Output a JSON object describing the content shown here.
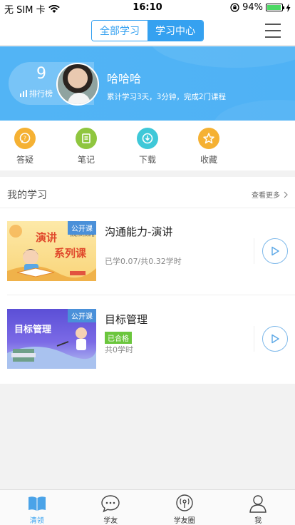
{
  "status_bar": {
    "carrier": "无 SIM 卡",
    "time": "16:10",
    "battery_text": "94%",
    "battery_level": 0.94
  },
  "nav": {
    "tabs": [
      {
        "label": "全部学习",
        "active": false
      },
      {
        "label": "学习中心",
        "active": true
      }
    ]
  },
  "profile": {
    "rank_number": "9",
    "rank_label": "排行榜",
    "name": "哈哈哈",
    "summary": "累计学习3天，3分钟，完成2门课程"
  },
  "quick_actions": [
    {
      "label": "答疑",
      "icon": "qa-icon",
      "color": "#f5b133"
    },
    {
      "label": "笔记",
      "icon": "note-icon",
      "color": "#8fc63f"
    },
    {
      "label": "下载",
      "icon": "download-icon",
      "color": "#3fc8d8"
    },
    {
      "label": "收藏",
      "icon": "star-icon",
      "color": "#f5b133"
    }
  ],
  "study": {
    "title": "我的学习",
    "more_label": "查看更多",
    "courses": [
      {
        "title": "沟通能力-演讲",
        "progress": "已学0.07/共0.32学时",
        "tag": "公开课",
        "thumb_title": "演讲",
        "thumb_subtitle": "系列课",
        "thumb_small": "我是你的演讲官"
      },
      {
        "title": "目标管理",
        "badge": "已合格",
        "progress": "共0学时",
        "tag": "公开课",
        "thumb_title": "目标管理"
      }
    ]
  },
  "tab_bar": [
    {
      "label": "清领",
      "icon": "book-icon",
      "active": true
    },
    {
      "label": "学友",
      "icon": "chat-icon",
      "active": false
    },
    {
      "label": "学友圈",
      "icon": "broadcast-icon",
      "active": false
    },
    {
      "label": "我",
      "icon": "person-icon",
      "active": false
    }
  ],
  "colors": {
    "accent": "#35a1f0",
    "banner": "#52b4f5",
    "badge_green": "#6bc63d"
  }
}
